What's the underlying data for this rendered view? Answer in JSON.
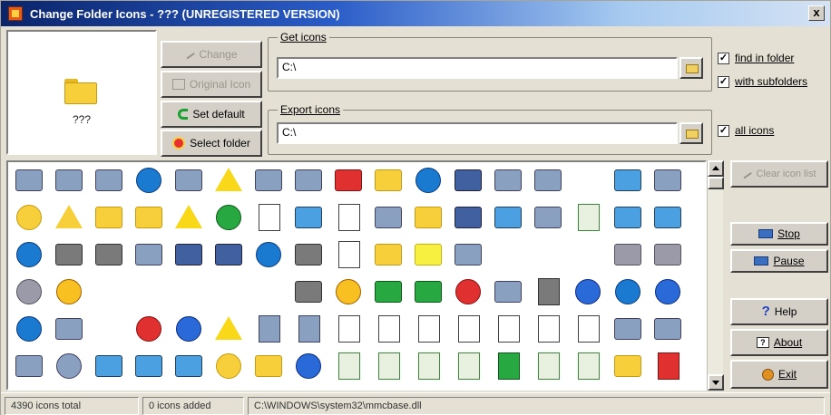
{
  "window": {
    "title": "Change Folder Icons - ??? (UNREGISTERED VERSION)",
    "close_label": "x"
  },
  "preview": {
    "label": "???"
  },
  "buttons": {
    "change": "Change",
    "original_icon": "Original Icon",
    "set_default": "Set default",
    "select_folder": "Select folder"
  },
  "get_icons": {
    "title": "Get icons",
    "path": "C:\\",
    "find_in_folder": "find in folder",
    "with_subfolders": "with subfolders"
  },
  "export_icons": {
    "title": "Export icons",
    "path": "C:\\",
    "all_icons": "all icons"
  },
  "side_buttons": {
    "clear_icon_list": "Clear icon list",
    "stop": "Stop",
    "pause": "Pause",
    "help": "Help",
    "about": "About",
    "exit": "Exit"
  },
  "status": {
    "total": "4390 icons total",
    "added": "0 icons added",
    "file": "C:\\WINDOWS\\system32\\mmcbase.dll"
  },
  "colors": {
    "title_start": "#0a246a",
    "title_end": "#d4e2f4",
    "face": "#e4e0d4",
    "folder": "#f6cf3a"
  },
  "icon_rows": [
    [
      "book-phone-icon",
      "download-gear-icon",
      "calendar-clock-icon",
      "globe-stand-icon",
      "telephone-icon",
      "warning-triangle-icon",
      "world-computer-icon",
      "hourglass-icon",
      "red-x-icon",
      "folder-icon",
      "globe-icon",
      "window-frame-icon",
      "blue-square-icon",
      "tree-diagram-icon",
      "",
      "network-computer-icon",
      "brown-rock-icon"
    ],
    [
      "info-folder-icon",
      "warning-folder-icon",
      "help-folder-icon",
      "key-folder-icon",
      "warning-triangle-icon",
      "green-check-icon",
      "ie-document-icon",
      "computer-network-icon",
      "document-person-icon",
      "paper-tube-icon",
      "lock-folder-icon",
      "window-shutter-icon",
      "server-network-icon",
      "server-pipes-icon",
      "certificate-icon",
      "network-cable-icon",
      "network-diamond-icon"
    ],
    [
      "globe-rope-icon",
      "clapper-icon",
      "clapper-321-icon",
      "lightbulb-icon",
      "window-stack-icon",
      "window-bar-icon",
      "globe-cog-icon",
      "clapper-gear-icon",
      "doc-321-icon",
      "folder-star-icon",
      "yellow-scribble-icon",
      "spark-icon",
      "",
      "",
      "",
      "storm-cloud-icon",
      "grey-cloud-icon"
    ],
    [
      "sun-cloud-icon",
      "sun-face-icon",
      "",
      "",
      "",
      "",
      "",
      "clapper-321-icon",
      "sunset-icon",
      "green-arrows-icon",
      "green-arrow-right-icon",
      "red-x-circle-icon",
      "keys-person-icon",
      "clapper-doc-icon",
      "info-bubble-icon",
      "globe-green-icon",
      "info-blue-icon"
    ],
    [
      "star-globe-icon",
      "small-arrow-icon",
      "",
      "red-x-circle-icon",
      "info-speech-icon",
      "warning-triangle-icon",
      "text-a-icon",
      "text-a-small-icon",
      "doc-lines-icon",
      "doc-lines-small-icon",
      "doc-tall-icon",
      "doc-dual-icon",
      "doc-column-icon",
      "doc-page-icon",
      "doc-grid-icon",
      "blocks-list-icon",
      "lines-list-icon"
    ],
    [
      "printer-icon",
      "help-circle-icon",
      "network-cluster-icon",
      "network-cluster-icon",
      "network-cluster-icon",
      "globe-folder-icon",
      "folder-tan-icon",
      "info-doc-icon",
      "cert-ribbon-icon",
      "cert-ribbon-icon",
      "cert-blue-icon",
      "cert-x-icon",
      "cert-green-icon",
      "cert-x-icon",
      "cert-stack-icon",
      "folder-stack-icon",
      "cert-red-icon"
    ]
  ]
}
